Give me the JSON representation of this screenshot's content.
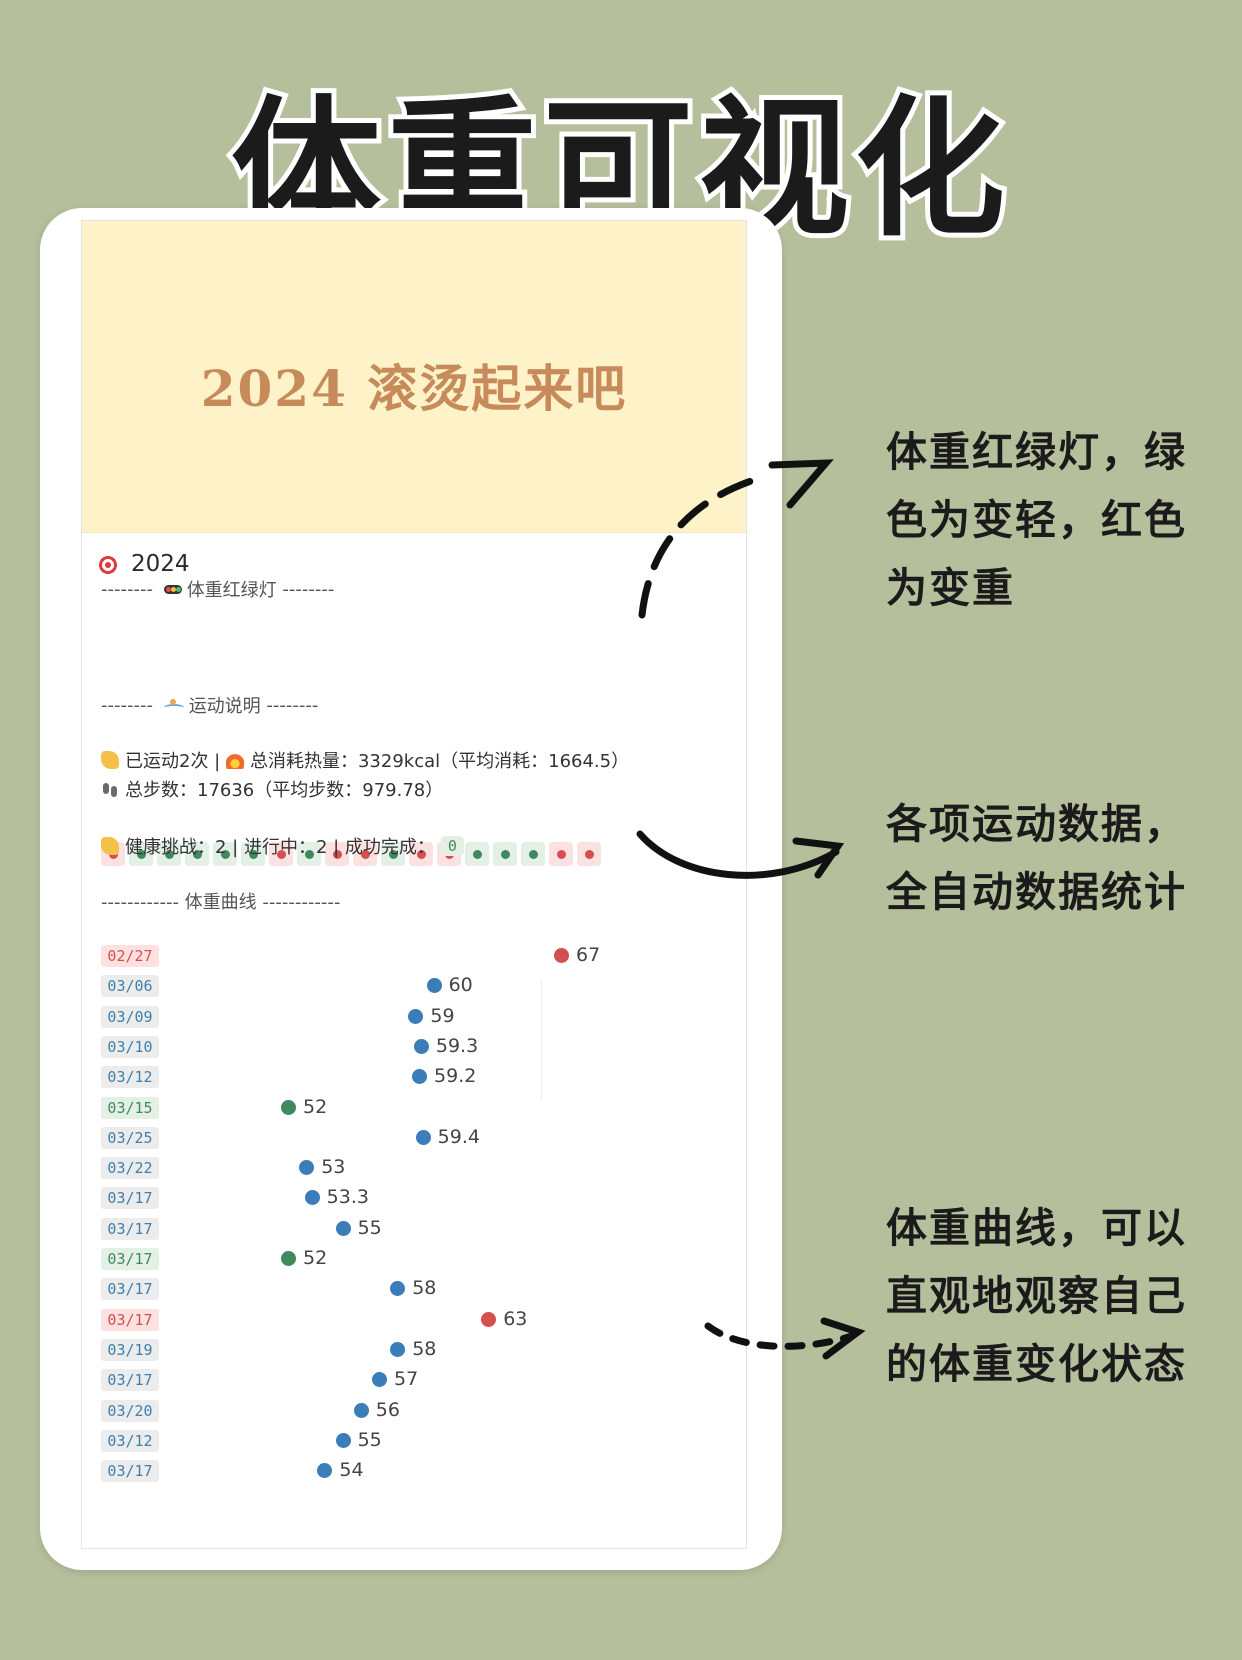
{
  "headline": "体重可视化",
  "cover_text": "2024 滚烫起来吧",
  "page_title": "2024",
  "section_traffic": {
    "left": "-------- ",
    "label": "体重红绿灯",
    "right": " --------"
  },
  "traffic_lights": [
    "red",
    "green",
    "green",
    "green",
    "green",
    "green",
    "red",
    "green",
    "red",
    "red",
    "green",
    "red",
    "red",
    "green",
    "green",
    "green",
    "red",
    "red"
  ],
  "section_sport": {
    "left": "-------- ",
    "label": "运动说明",
    "right": " --------"
  },
  "stats": {
    "line1_a": "已运动2次 | ",
    "line1_b": "总消耗热量：3329kcal（平均消耗：1664.5）",
    "line2": "总步数：17636（平均步数：979.78）",
    "line3": "健康挑战：2 | 进行中：2 | 成功完成：",
    "completed": "0"
  },
  "section_curve": "------------ 体重曲线 ------------",
  "weight_entries": [
    {
      "date": "02/27",
      "weight": "67",
      "status": "red"
    },
    {
      "date": "03/06",
      "weight": "60",
      "status": "blue"
    },
    {
      "date": "03/09",
      "weight": "59",
      "status": "blue"
    },
    {
      "date": "03/10",
      "weight": "59.3",
      "status": "blue"
    },
    {
      "date": "03/12",
      "weight": "59.2",
      "status": "blue"
    },
    {
      "date": "03/15",
      "weight": "52",
      "status": "green"
    },
    {
      "date": "03/25",
      "weight": "59.4",
      "status": "blue"
    },
    {
      "date": "03/22",
      "weight": "53",
      "status": "blue"
    },
    {
      "date": "03/17",
      "weight": "53.3",
      "status": "blue"
    },
    {
      "date": "03/17",
      "weight": "55",
      "status": "blue"
    },
    {
      "date": "03/17",
      "weight": "52",
      "status": "green"
    },
    {
      "date": "03/17",
      "weight": "58",
      "status": "blue"
    },
    {
      "date": "03/17",
      "weight": "63",
      "status": "red"
    },
    {
      "date": "03/19",
      "weight": "58",
      "status": "blue"
    },
    {
      "date": "03/17",
      "weight": "57",
      "status": "blue"
    },
    {
      "date": "03/20",
      "weight": "56",
      "status": "blue"
    },
    {
      "date": "03/12",
      "weight": "55",
      "status": "blue"
    },
    {
      "date": "03/17",
      "weight": "54",
      "status": "blue"
    }
  ],
  "notes": {
    "traffic": [
      "体重红绿灯，绿",
      "色为变轻，红色",
      "为变重"
    ],
    "sport": [
      "各项运动数据，",
      "全自动数据统计"
    ],
    "curve": [
      "体重曲线，可以",
      "直观地观察自己",
      "的体重变化状态"
    ]
  },
  "colors": {
    "background": "#b5bf9c",
    "cover": "#fdf2c8",
    "cover_text": "#c78a5a",
    "red": "#d54f4f",
    "green": "#3f8a5d",
    "blue": "#3a7db8"
  }
}
